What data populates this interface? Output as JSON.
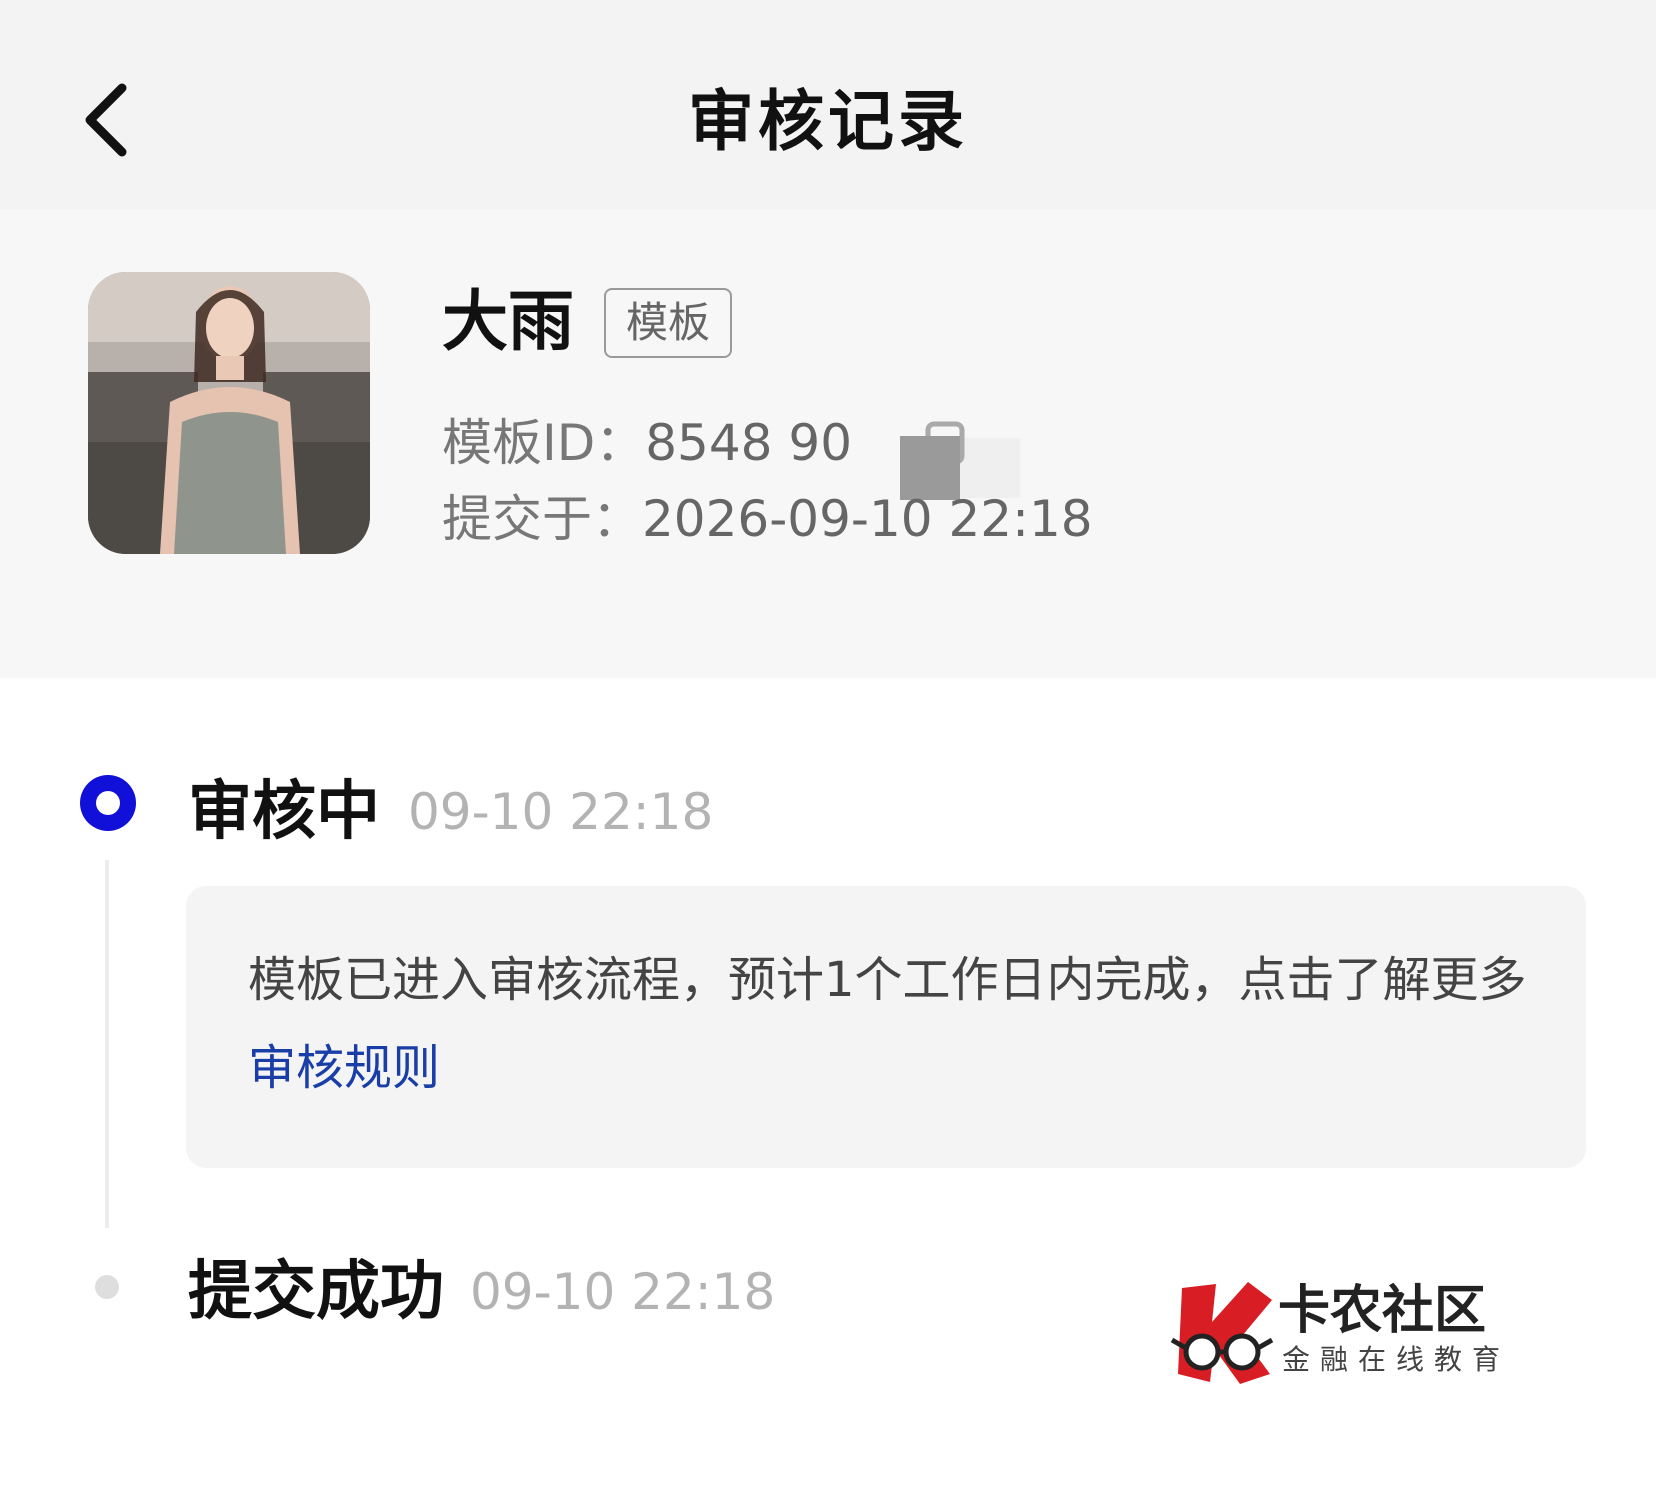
{
  "nav": {
    "title": "审核记录"
  },
  "template": {
    "name": "大雨",
    "badge": "模板",
    "id_label": "模板ID：",
    "id_value": "8548      90",
    "submitted_label": "提交于：",
    "submitted_value": "2026-09-10 22:18"
  },
  "timeline": [
    {
      "status": "审核中",
      "time": "09-10 22:18",
      "active": true
    },
    {
      "status": "提交成功",
      "time": "09-10 22:18",
      "active": false
    }
  ],
  "note": {
    "text": "模板已进入审核流程，预计1个工作日内完成，点击了解更多",
    "link": "审核规则"
  },
  "watermark": {
    "title": "卡农社区",
    "subtitle": "金融在线教育"
  },
  "colors": {
    "accent": "#1010d8",
    "link": "#1a3ea8",
    "nav_bg": "#f3f3f3"
  }
}
